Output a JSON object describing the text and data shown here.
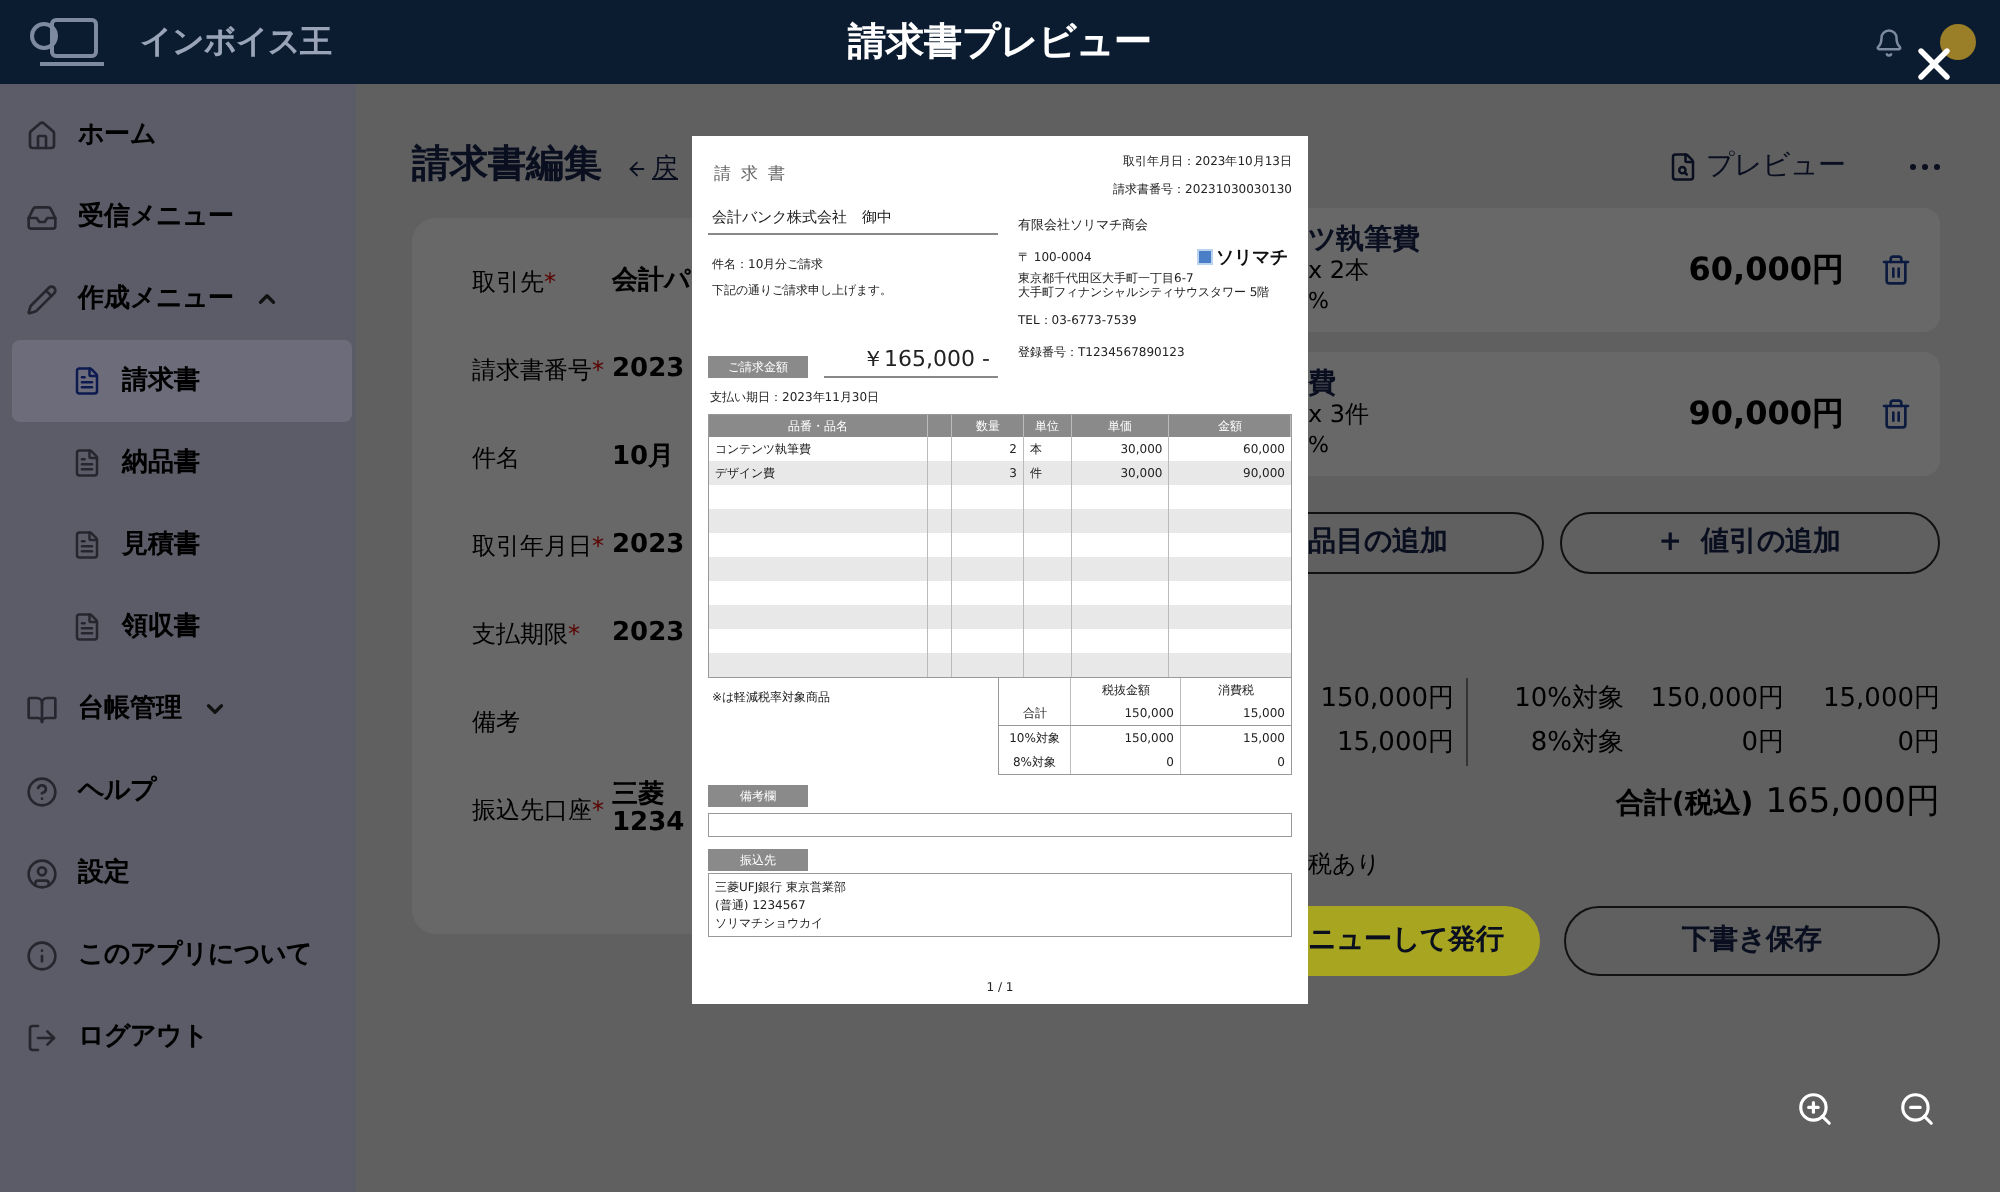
{
  "header": {
    "logo_text": "インボイス王",
    "title": "請求書プレビュー"
  },
  "sidebar": {
    "items": [
      {
        "label": "ホーム",
        "selected": false
      },
      {
        "label": "受信メニュー",
        "selected": false
      },
      {
        "label": "作成メニュー",
        "selected": false,
        "expanded": true,
        "children": [
          {
            "label": "請求書",
            "selected": true
          },
          {
            "label": "納品書",
            "selected": false
          },
          {
            "label": "見積書",
            "selected": false
          },
          {
            "label": "領収書",
            "selected": false
          }
        ]
      },
      {
        "label": "台帳管理",
        "selected": false,
        "expanded": false
      },
      {
        "label": "ヘルプ",
        "selected": false
      },
      {
        "label": "設定",
        "selected": false
      },
      {
        "label": "このアプリについて",
        "selected": false
      },
      {
        "label": "ログアウト",
        "selected": false
      }
    ]
  },
  "editor": {
    "title": "請求書編集",
    "back_link": "戻",
    "fields": [
      {
        "label": "取引先",
        "required_mark": "*",
        "value": "会計パ"
      },
      {
        "label": "請求書番号",
        "required_mark": "*",
        "value": "2023"
      },
      {
        "label": "件名",
        "value": "10月"
      },
      {
        "label": "取引年月日",
        "required_mark": "*",
        "value": "2023"
      },
      {
        "label": "支払期限",
        "required_mark": "*",
        "value": "2023"
      },
      {
        "label": "備考"
      },
      {
        "label": "振込先口座",
        "required_mark": "*",
        "value": "三菱",
        "value_2": "1234"
      }
    ]
  },
  "lines": {
    "preview_button": "プレビュー",
    "items": [
      {
        "name": "ツ執筆費",
        "qty": "x 2本",
        "tax": "%",
        "amount": "60,000円"
      },
      {
        "name": "費",
        "qty": "x 3件",
        "tax": "%",
        "amount": "90,000円"
      }
    ],
    "add_item_button": "品目の追加",
    "add_discount_button": "+  値引の追加",
    "subtotals": [
      "150,000円",
      "15,000円"
    ],
    "tax_rows": [
      {
        "label": "10%対象",
        "base": "150,000円",
        "tax": "15,000円"
      },
      {
        "label": "8%対象",
        "base": "0円",
        "tax": "0円"
      }
    ],
    "total_label": "合計(税込)",
    "total": "165,000円",
    "note": "税あり",
    "issue_button": "ニューして発行",
    "draft_button": "下書き保存"
  },
  "preview": {
    "doc_title": "請求書",
    "date": "取引年月日：2023年10月13日",
    "number": "請求書番号：20231030030130",
    "customer": "会計バンク株式会社　御中",
    "subject": "件名：10月分ご請求",
    "message": "下記の通りご請求申し上げます。",
    "issuer_name": "有限会社ソリマチ商会",
    "issuer_lines": [
      "〒 100-0004",
      "東京都千代田区大手町一丁目6-7",
      "大手町フィナンシャルシティサウスタワー 5階"
    ],
    "tel": "TEL：03-6773-7539",
    "logo": "ソリマチ",
    "registration": "登録番号：T1234567890123",
    "amount_label": "ご請求金額",
    "amount": "￥165,000 -",
    "due": "支払い期日：2023年11月30日",
    "columns": [
      "品番・品名",
      "数量",
      "単位",
      "単価",
      "金額"
    ],
    "rows": [
      {
        "name": "コンテンツ執筆費",
        "qty": "2",
        "unit": "本",
        "price": "30,000",
        "amount": "60,000"
      },
      {
        "name": "デザイン費",
        "qty": "3",
        "unit": "件",
        "price": "30,000",
        "amount": "90,000"
      }
    ],
    "note": "※は軽減税率対象商品",
    "tax_columns": [
      "税抜金額",
      "消費税"
    ],
    "tax_rows": [
      {
        "label": "合計",
        "base": "150,000",
        "tax": "15,000"
      },
      {
        "label": "10%対象",
        "base": "150,000",
        "tax": "15,000"
      },
      {
        "label": "8%対象",
        "base": "0",
        "tax": "0"
      }
    ],
    "remarks_label": "備考欄",
    "bank_label": "振込先",
    "bank_lines": [
      "三菱UFJ銀行 東京営業部",
      "(普通) 1234567",
      "ソリマチショウカイ"
    ],
    "page": "1 / 1"
  }
}
